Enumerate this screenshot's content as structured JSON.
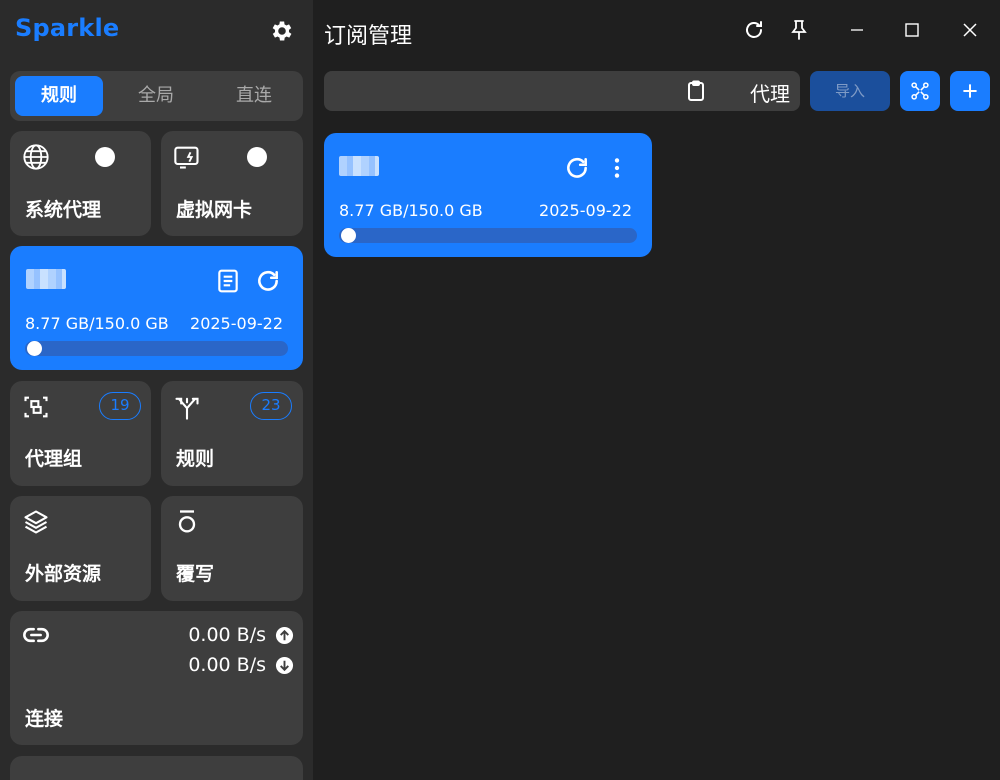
{
  "app": {
    "brand": "Sparkle"
  },
  "sidebar": {
    "mode_tabs": [
      {
        "label": "规则",
        "active": true
      },
      {
        "label": "全局",
        "active": false
      },
      {
        "label": "直连",
        "active": false
      }
    ],
    "system_proxy": {
      "label": "系统代理",
      "icon": "globe-icon"
    },
    "tun": {
      "label": "虚拟网卡",
      "icon": "tun-icon"
    },
    "profile": {
      "traffic": "8.77 GB/150.0 GB",
      "expire": "2025-09-22",
      "progress": 0.058
    },
    "proxy_groups": {
      "label": "代理组",
      "count": "19"
    },
    "rules": {
      "label": "规则",
      "count": "23"
    },
    "resources": {
      "label": "外部资源"
    },
    "override": {
      "label": "覆写"
    },
    "connections": {
      "label": "连接",
      "upload": "0.00 B/s",
      "download": "0.00 B/s"
    }
  },
  "main": {
    "title": "订阅管理",
    "search": {
      "suffix": "代理",
      "value": ""
    },
    "import_label": "导入",
    "profile_card": {
      "traffic": "8.77 GB/150.0 GB",
      "expire": "2025-09-22",
      "progress": 0.058
    }
  },
  "colors": {
    "accent": "#1a7dff",
    "sidebar_bg": "#2b2b2b",
    "main_bg": "#1f1f1f",
    "card_bg": "#3e3e3e"
  }
}
